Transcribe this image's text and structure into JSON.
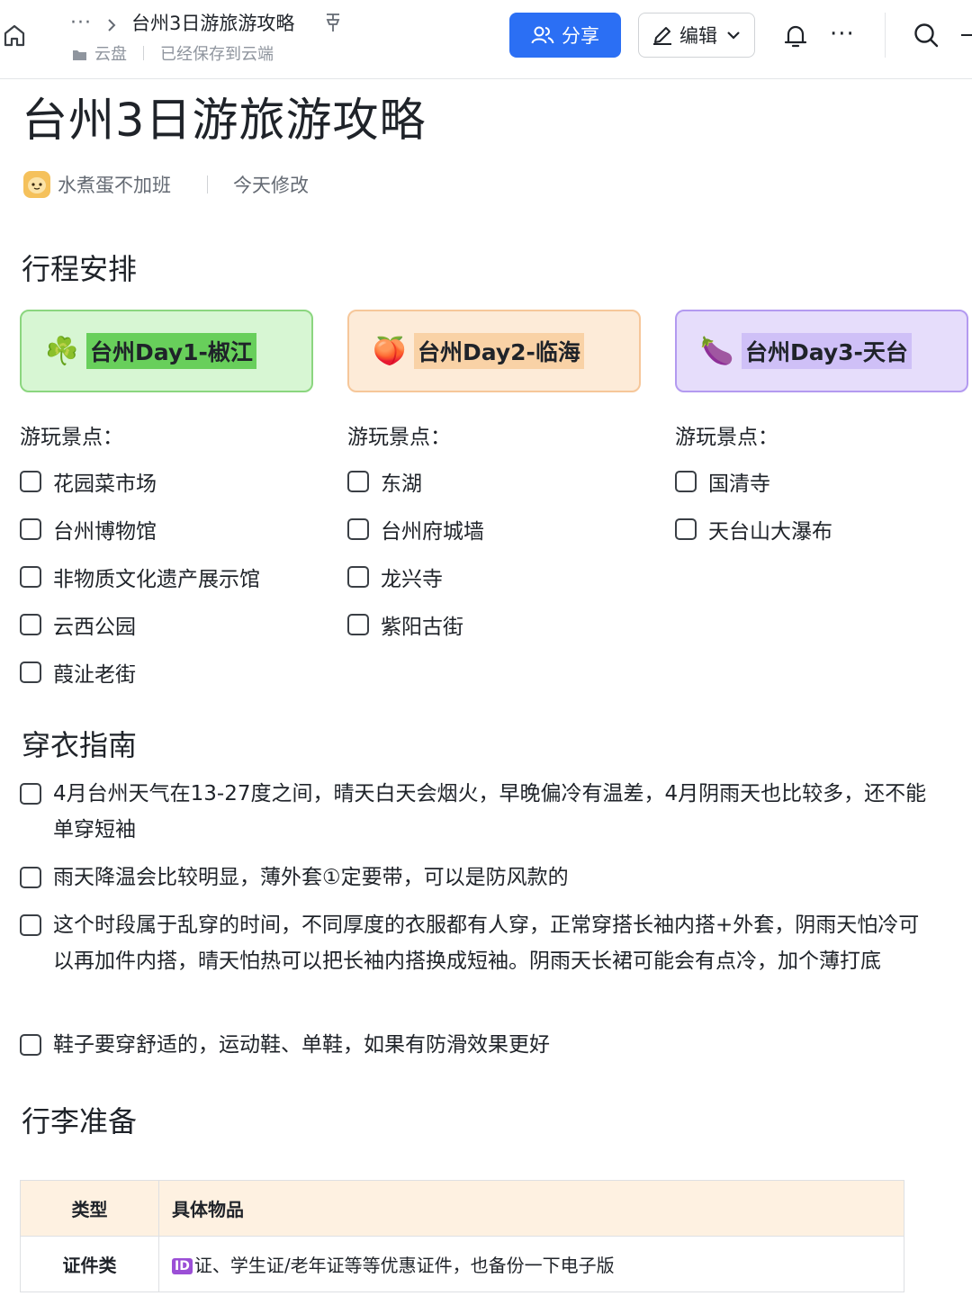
{
  "breadcrumb": {
    "more": "···",
    "doc_name": "台州3日游旅游攻略",
    "location": "云盘",
    "save_status": "已经保存到云端"
  },
  "toolbar": {
    "share_label": "分享",
    "edit_label": "编辑",
    "more": "···",
    "accent_color": "#2b6ff4"
  },
  "doc": {
    "title": "台州3日游旅游攻略",
    "author": "水煮蛋不加班",
    "modified": "今天修改"
  },
  "itinerary": {
    "heading": "行程安排",
    "spots_label": "游玩景点：",
    "days": [
      {
        "emoji": "☘️",
        "label": "台州Day1-椒江",
        "spots": [
          "花园菜市场",
          "台州博物馆",
          "非物质文化遗产展示馆",
          "云西公园",
          "葭沚老街"
        ]
      },
      {
        "emoji": "🍑",
        "label": "台州Day2-临海",
        "spots": [
          "东湖",
          "台州府城墙",
          "龙兴寺",
          "紫阳古街"
        ]
      },
      {
        "emoji": "🍆",
        "label": "台州Day3-天台",
        "spots": [
          "国清寺",
          "天台山大瀑布"
        ]
      }
    ]
  },
  "clothing": {
    "heading": "穿衣指南",
    "items": [
      "4月台州天气在13-27度之间，晴天白天会烟火，早晚偏冷有温差，4月阴雨天也比较多，还不能单穿短袖",
      "雨天降温会比较明显，薄外套①定要带，可以是防风款的",
      "这个时段属于乱穿的时间，不同厚度的衣服都有人穿，正常穿搭长袖内搭+外套，阴雨天怕冷可以再加件内搭，晴天怕热可以把长袖内搭换成短袖。阴雨天长裙可能会有点冷，加个薄打底",
      "鞋子要穿舒适的，运动鞋、单鞋，如果有防滑效果更好"
    ]
  },
  "luggage": {
    "heading": "行李准备",
    "col_type": "类型",
    "col_items": "具体物品",
    "rows": [
      {
        "type": "证件类",
        "tag": "ID",
        "items": "证、学生证/老年证等等优惠证件，也备份一下电子版"
      }
    ]
  }
}
